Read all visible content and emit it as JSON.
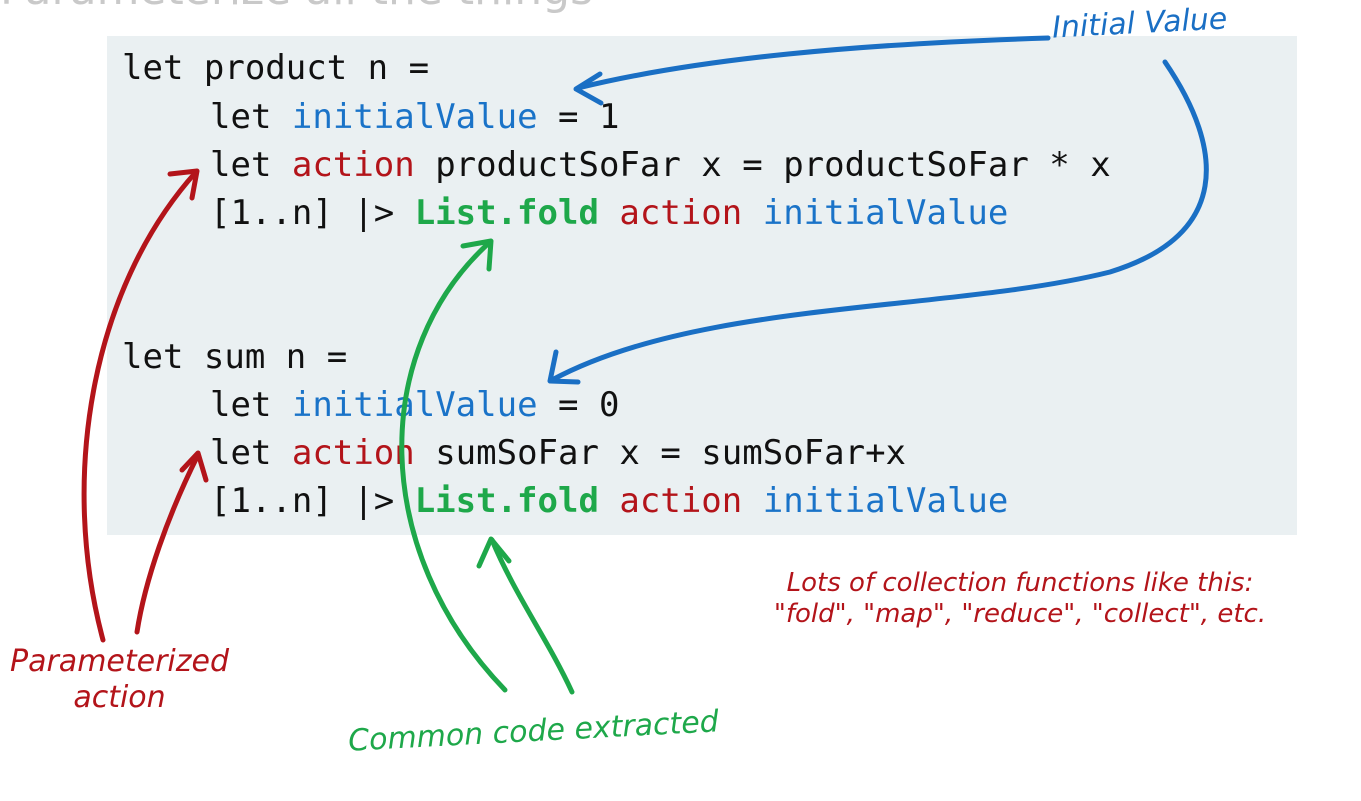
{
  "slide": {
    "title": "Parameterize all the things"
  },
  "code": {
    "product": {
      "line1": {
        "kw": "let",
        "rest": " product n ="
      },
      "line2": {
        "kw": "let",
        "name": "initialValue",
        "rest": " = 1"
      },
      "line3": {
        "kw": "let",
        "name": "action",
        "rest": " productSoFar x = productSoFar * x"
      },
      "line4": {
        "prefix": "[1..n] |> ",
        "fold": "List.fold",
        "action": "action",
        "init": "initialValue"
      }
    },
    "sum": {
      "line1": {
        "kw": "let",
        "rest": " sum n ="
      },
      "line2": {
        "kw": "let",
        "name": "initialValue",
        "rest": " = 0"
      },
      "line3": {
        "kw": "let",
        "name": "action",
        "rest": " sumSoFar x = sumSoFar+x"
      },
      "line4": {
        "prefix": "[1..n] |> ",
        "fold": "List.fold",
        "action": "action",
        "init": "initialValue"
      }
    }
  },
  "annotations": {
    "initial_value": "Initial Value",
    "parameterized_action_line1": "Parameterized",
    "parameterized_action_line2": "action",
    "common_code": "Common code extracted",
    "collections_line1": "Lots of collection functions like this:",
    "collections_line2": "\"fold\", \"map\", \"reduce\", \"collect\", etc."
  },
  "colors": {
    "code_background": "#eaf0f2",
    "keyword_blue": "#1a73c8",
    "keyword_red": "#b3141a",
    "keyword_green": "#1ea84a",
    "title_gray": "#c9c9c9"
  }
}
